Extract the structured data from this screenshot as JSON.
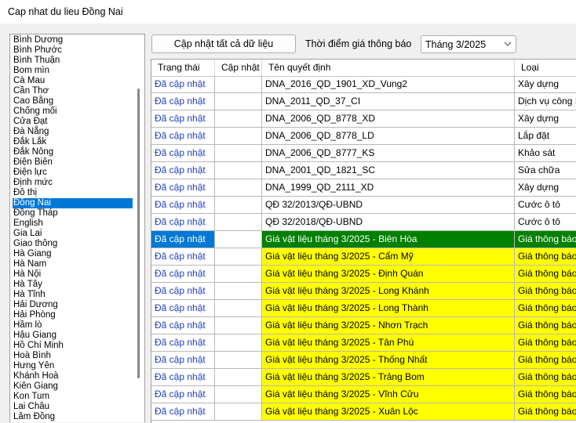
{
  "window": {
    "title": "Cap nhat du lieu Đồng Nai"
  },
  "provinces": [
    "Bình Dương",
    "Bình Phước",
    "Bình Thuận",
    "Bom mìn",
    "Cà Mau",
    "Cần Thơ",
    "Cao Bằng",
    "Chống mối",
    "Cửa Đạt",
    "Đà Nẵng",
    "Đắk Lắk",
    "Đắk Nông",
    "Điện Biên",
    "Điện lực",
    "Định mức",
    "Đô thị",
    "Đồng Nai",
    "Đồng Tháp",
    "English",
    "Gia Lai",
    "Giao thông",
    "Hà Giang",
    "Hà Nam",
    "Hà Nội",
    "Hà Tây",
    "Hà Tĩnh",
    "Hải Dương",
    "Hải Phòng",
    "Hầm lò",
    "Hậu Giang",
    "Hồ Chí Minh",
    "Hoà Bình",
    "Hưng Yên",
    "Khánh Hoà",
    "Kiên Giang",
    "Kon Tum",
    "Lai Châu",
    "Lâm Đồng"
  ],
  "selected_province": "Đồng Nai",
  "toolbar": {
    "update_all_label": "Cập nhật tất cả dữ liệu",
    "time_label": "Thời điểm giá thông báo",
    "time_value": "Tháng 3/2025"
  },
  "table": {
    "columns": [
      "Trạng thái",
      "Cập nhật",
      "Tên quyết định",
      "Loại"
    ],
    "rows": [
      {
        "status": "Đã cập nhật",
        "update": "",
        "name": "DNA_2016_QD_1901_XD_Vung2",
        "type": "Xây dựng"
      },
      {
        "status": "Đã cập nhật",
        "update": "",
        "name": "DNA_2011_QD_37_CI",
        "type": "Dịch vụ công ích"
      },
      {
        "status": "Đã cập nhật",
        "update": "",
        "name": "DNA_2006_QD_8778_XD",
        "type": "Xây dựng"
      },
      {
        "status": "Đã cập nhật",
        "update": "",
        "name": "DNA_2006_QD_8778_LD",
        "type": "Lắp đặt"
      },
      {
        "status": "Đã cập nhật",
        "update": "",
        "name": "DNA_2006_QD_8777_KS",
        "type": "Khảo sát"
      },
      {
        "status": "Đã cập nhật",
        "update": "",
        "name": "DNA_2001_QD_1821_SC",
        "type": "Sửa chữa"
      },
      {
        "status": "Đã cập nhật",
        "update": "",
        "name": "DNA_1999_QD_2111_XD",
        "type": "Xây dựng"
      },
      {
        "status": "Đã cập nhật",
        "update": "",
        "name": "QĐ 32/2013/QĐ-UBND",
        "type": "Cước ô tô"
      },
      {
        "status": "Đã cập nhật",
        "update": "",
        "name": "QĐ 32/2018/QĐ-UBND",
        "type": "Cước ô tô"
      },
      {
        "status": "Đã cập nhật",
        "update": "",
        "name": "Giá vật liệu tháng 3/2025 - Biên Hòa",
        "type": "Giá thông báo"
      },
      {
        "status": "Đã cập nhật",
        "update": "",
        "name": "Giá vật liệu tháng 3/2025 - Cẩm Mỹ",
        "type": "Giá thông báo"
      },
      {
        "status": "Đã cập nhật",
        "update": "",
        "name": "Giá vật liệu tháng 3/2025 - Định Quán",
        "type": "Giá thông báo"
      },
      {
        "status": "Đã cập nhật",
        "update": "",
        "name": "Giá vật liệu tháng 3/2025 - Long Khánh",
        "type": "Giá thông báo"
      },
      {
        "status": "Đã cập nhật",
        "update": "",
        "name": "Giá vật liệu tháng 3/2025 - Long Thành",
        "type": "Giá thông báo"
      },
      {
        "status": "Đã cập nhật",
        "update": "",
        "name": "Giá vật liệu tháng 3/2025 - Nhơn Trạch",
        "type": "Giá thông báo"
      },
      {
        "status": "Đã cập nhật",
        "update": "",
        "name": "Giá vật liệu tháng 3/2025 - Tân Phú",
        "type": "Giá thông báo"
      },
      {
        "status": "Đã cập nhật",
        "update": "",
        "name": "Giá vật liệu tháng 3/2025 - Thống Nhất",
        "type": "Giá thông báo"
      },
      {
        "status": "Đã cập nhật",
        "update": "",
        "name": "Giá vật liệu tháng 3/2025 - Trảng Bom",
        "type": "Giá thông báo"
      },
      {
        "status": "Đã cập nhật",
        "update": "",
        "name": "Giá vật liệu tháng 3/2025 - Vĩnh Cửu",
        "type": "Giá thông báo"
      },
      {
        "status": "Đã cập nhật",
        "update": "",
        "name": "Giá vật liệu tháng 3/2025 - Xuân Lộc",
        "type": "Giá thông báo"
      }
    ],
    "selected_row": 9,
    "highlight_from": 9
  },
  "colors": {
    "highlight": "#ffff00",
    "selected_row": "#008000",
    "selection": "#0078d7",
    "status_text": "#1f3fbf"
  },
  "icons": {
    "combo": "chevron-down-icon"
  }
}
